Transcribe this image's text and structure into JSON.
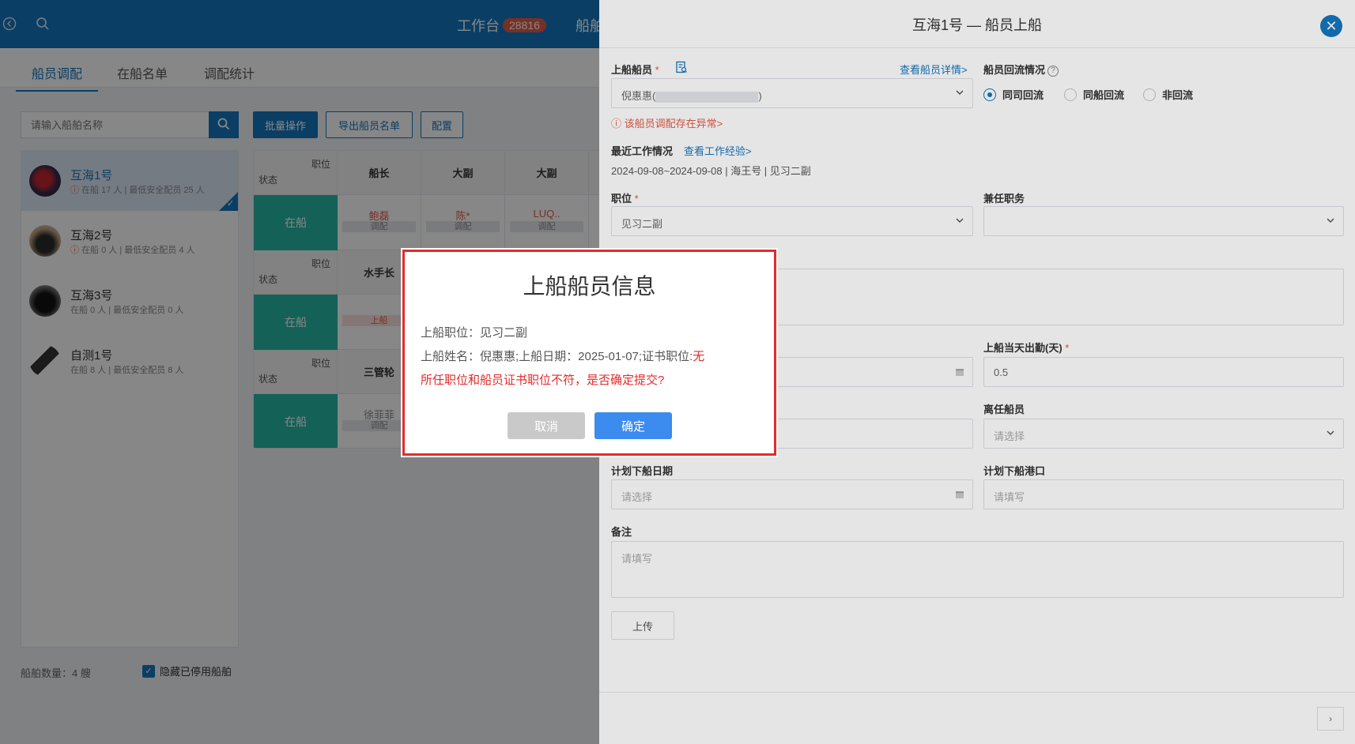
{
  "topbar": {
    "workbench": "工作台",
    "badge": "28816",
    "ship_label": "船舶"
  },
  "tabs": [
    "船员调配",
    "在船名单",
    "调配统计"
  ],
  "search": {
    "placeholder": "请输入船舶名称"
  },
  "ships": [
    {
      "name": "互海1号",
      "meta_prefix": "ⓘ",
      "meta": "在船 17 人 | 最低安全配员 25 人",
      "warn": true,
      "active": true
    },
    {
      "name": "互海2号",
      "meta_prefix": "ⓘ",
      "meta": "在船 0 人 | 最低安全配员 4 人",
      "warn": true,
      "active": false
    },
    {
      "name": "互海3号",
      "meta_prefix": "",
      "meta": "在船 0 人 | 最低安全配员 0 人",
      "warn": false,
      "active": false
    },
    {
      "name": "自测1号",
      "meta_prefix": "",
      "meta": "在船 8 人 | 最低安全配员 8 人",
      "warn": false,
      "active": false
    }
  ],
  "ship_count": "船舶数量：4 艘",
  "hide_disabled": "隐藏已停用船舶",
  "actions": {
    "batch": "批量操作",
    "export": "导出船员名单",
    "config": "配置"
  },
  "grid": {
    "corner_position": "职位",
    "corner_state": "状态",
    "row1_headers": [
      "船长",
      "大副",
      "大副"
    ],
    "row2_header": "水手长",
    "row3_header": "三管轮",
    "state_label": "在船",
    "row1_cells": [
      {
        "name": "鲍磊",
        "tag": "调配"
      },
      {
        "name": "陈*",
        "tag": "调配"
      },
      {
        "name": "LUQ..",
        "tag": "调配"
      }
    ],
    "row2_cell": {
      "tag": "上船"
    },
    "row3_cell": {
      "name": "徐菲菲",
      "tag": "调配"
    }
  },
  "drawer": {
    "title": "互海1号 — 船员上船",
    "crew_label": "上船船员",
    "crew_value": "倪惠惠(",
    "crew_value_end": ")",
    "crew_detail_link": "查看船员详情>",
    "crew_error": "ⓘ 该船员调配存在异常>",
    "return_label": "船员回流情况",
    "return_options": [
      "同司回流",
      "同船回流",
      "非回流"
    ],
    "recent_label": "最近工作情况",
    "recent_link": "查看工作经验>",
    "recent_text": "2024-09-08~2024-09-08  | 海王号 | 见习二副",
    "position_label": "职位",
    "position_value": "见习二副",
    "concurrent_label": "兼任职务",
    "attendance_label": "上船当天出勤(天)",
    "attendance_value": "0.5",
    "leaving_label": "离任船员",
    "leaving_placeholder": "请选择",
    "plan_date_label": "计划下船日期",
    "plan_date_placeholder": "请选择",
    "plan_port_label": "计划下船港口",
    "plan_port_placeholder": "请填写",
    "remark_label": "备注",
    "remark_placeholder": "请填写",
    "upload": "上传"
  },
  "dialog": {
    "title": "上船船员信息",
    "line1": "上船职位：见习二副",
    "line2_normal": "上船姓名：倪惠惠;上船日期：2025-01-07;证书职位:",
    "line2_red": "无",
    "line3": "所任职位和船员证书职位不符，是否确定提交?",
    "cancel": "取消",
    "ok": "确定"
  },
  "colors": {
    "brand": "#1476bf",
    "teal": "#26b8a6",
    "alert": "#e32b2b",
    "confirm": "#3c8bef"
  }
}
